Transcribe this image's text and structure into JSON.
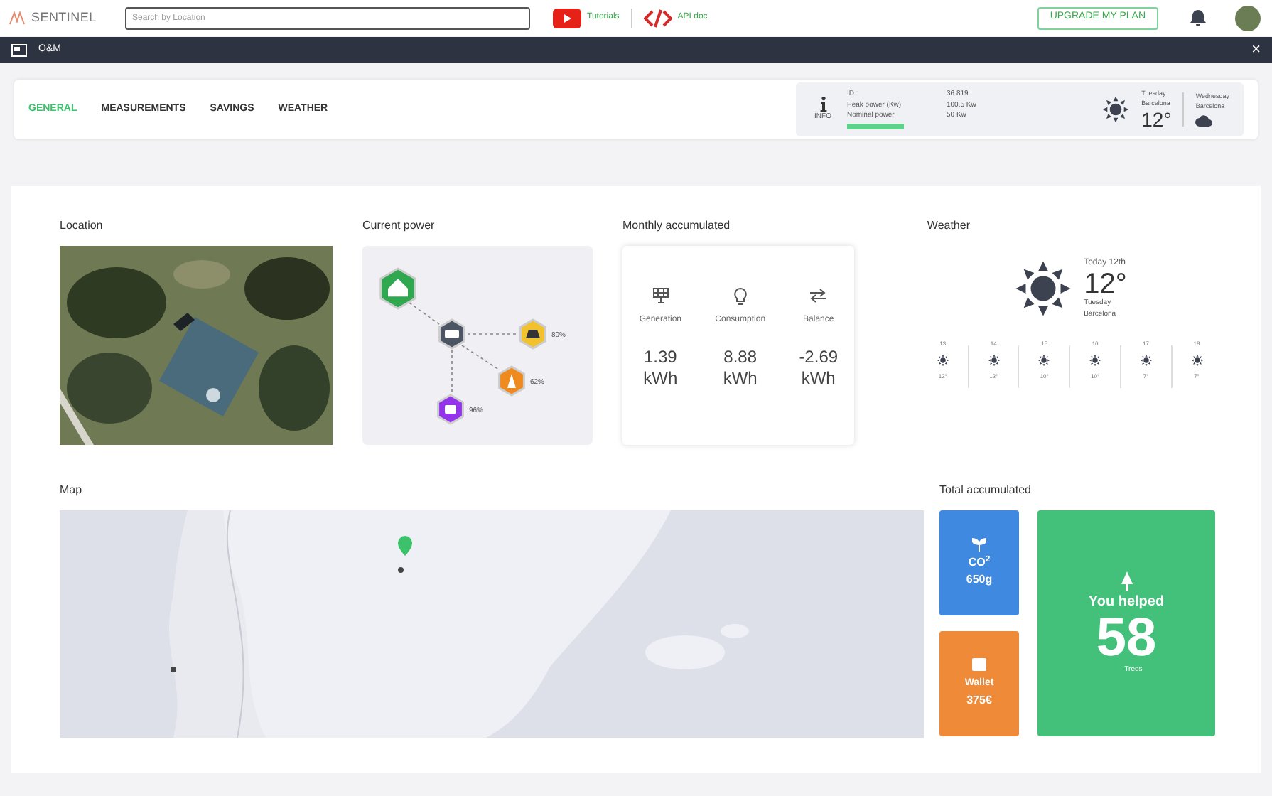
{
  "topbar": {
    "brand": "SENTINEL",
    "search": {
      "placeholder": "Search by Location"
    },
    "links": [
      {
        "kind": "video",
        "label": "Tutorials"
      },
      {
        "kind": "code",
        "label": "API doc"
      }
    ],
    "upgrade": "UPGRADE MY PLAN"
  },
  "window": {
    "title": "O&M",
    "close": "×"
  },
  "tabs": [
    {
      "label": "GENERAL",
      "selected": true
    },
    {
      "label": "MEASUREMENTS",
      "selected": false
    },
    {
      "label": "SAVINGS",
      "selected": false
    },
    {
      "label": "WEATHER",
      "selected": false
    }
  ],
  "info": {
    "label": "INFO",
    "rows": [
      {
        "name": "ID :",
        "value": "36 819"
      },
      {
        "name": "Peak power (Kw)",
        "value": "100.5 Kw"
      },
      {
        "name": "Nominal power",
        "value": "50 Kw"
      }
    ],
    "today": {
      "day": "Tuesday",
      "city": "Barcelona",
      "temp": "12°"
    },
    "tomorrow": {
      "day": "Wednesday",
      "city": "Barcelona"
    }
  },
  "location": {
    "title": "Location"
  },
  "current_power": {
    "title": "Current power",
    "nodes": [
      {
        "kind": "home",
        "color": "#2fa84f"
      },
      {
        "kind": "inverter",
        "color": "#4b5563"
      },
      {
        "kind": "solar",
        "color": "#f2c12e",
        "reading": "80%"
      },
      {
        "kind": "grid",
        "color": "#ef8a1f",
        "reading": "62%"
      },
      {
        "kind": "battery",
        "color": "#9333ea",
        "reading": "96%"
      }
    ]
  },
  "monthly": {
    "title": "Monthly accumulated",
    "items": [
      {
        "kind": "generation",
        "label": "Generation",
        "value": "1.39",
        "unit": "kWh"
      },
      {
        "kind": "consumption",
        "label": "Consumption",
        "value": "8.88",
        "unit": "kWh"
      },
      {
        "kind": "balance",
        "label": "Balance",
        "value": "-2.69",
        "unit": "kWh"
      }
    ]
  },
  "weather": {
    "title": "Weather",
    "date": "Today 12th",
    "temp": "12°",
    "day": "Tuesday",
    "city": "Barcelona",
    "forecast": [
      {
        "day": "13",
        "temp": "12°"
      },
      {
        "day": "14",
        "temp": "12°"
      },
      {
        "day": "15",
        "temp": "10°"
      },
      {
        "day": "16",
        "temp": "10°"
      },
      {
        "day": "17",
        "temp": "7°"
      },
      {
        "day": "18",
        "temp": "7°"
      }
    ]
  },
  "map": {
    "title": "Map"
  },
  "total": {
    "title": "Total accumulated",
    "co2": {
      "label": "CO$^{2}$",
      "value": "650g"
    },
    "wallet": {
      "label": "Wallet",
      "value": "375€"
    },
    "trees": {
      "label": "You helped",
      "value": "58",
      "unit": "Trees"
    }
  }
}
